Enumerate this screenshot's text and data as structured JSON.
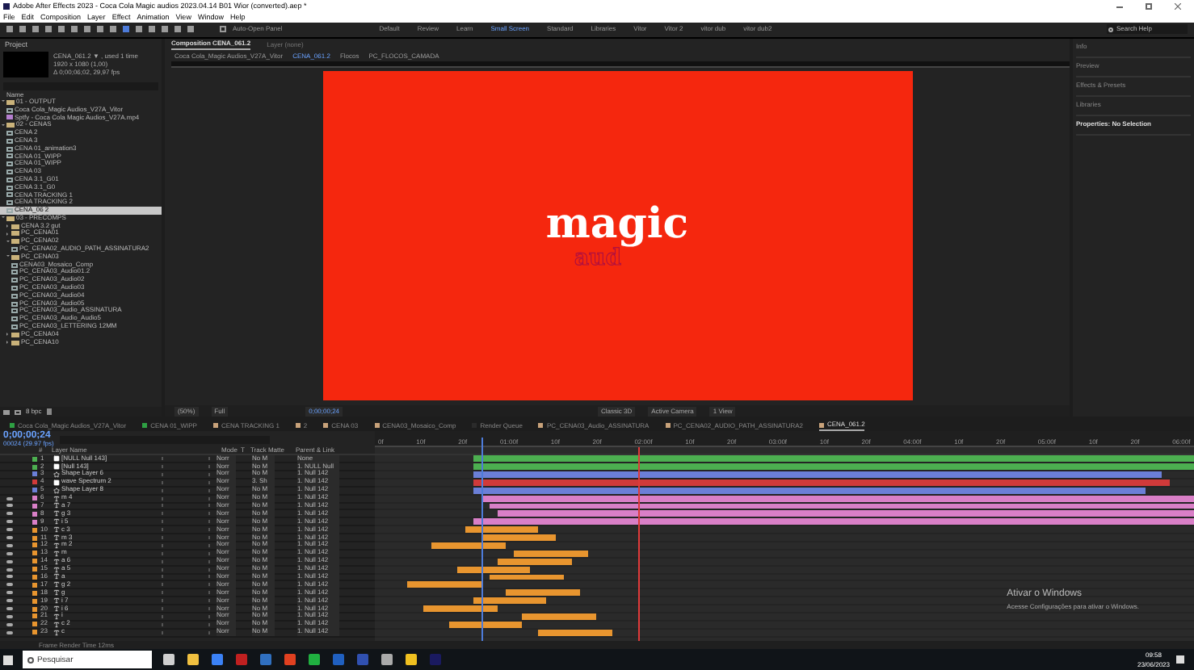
{
  "window": {
    "title": "Adobe After Effects 2023 - Coca Cola Magic audios 2023.04.14 B01 Wior (converted).aep *"
  },
  "menu": [
    "File",
    "Edit",
    "Composition",
    "Layer",
    "Effect",
    "Animation",
    "View",
    "Window",
    "Help"
  ],
  "toolbar": {
    "auto_open": "Auto-Open Panel",
    "workspaces": [
      {
        "label": "Default",
        "selected": false
      },
      {
        "label": "Review",
        "selected": false
      },
      {
        "label": "Learn",
        "selected": false
      },
      {
        "label": "Small Screen",
        "selected": true
      },
      {
        "label": "Standard",
        "selected": false
      },
      {
        "label": "Libraries",
        "selected": false
      },
      {
        "label": "Vitor",
        "selected": false
      },
      {
        "label": "Vitor 2",
        "selected": false
      },
      {
        "label": "vitor dub",
        "selected": false
      },
      {
        "label": "vitor dub2",
        "selected": false
      }
    ],
    "search": {
      "placeholder": "Search Help"
    }
  },
  "project": {
    "title": "Project",
    "info": [
      "CENA_061.2 ▼ , used 1 time",
      "1920 x 1080 (1,00)",
      "Δ 0;00;06;02, 29,97 fps"
    ],
    "column": "Name",
    "tree": [
      {
        "label": "01 - OUTPUT",
        "kind": "folder",
        "expanded": true,
        "selected": false,
        "children": [
          {
            "label": "Coca Cola_Magic Audios_V27A_Vitor",
            "kind": "comp",
            "selected": false
          },
          {
            "label": "Sptfy - Coca Cola Magic Audios_V27A.mp4",
            "kind": "footage",
            "selected": false
          }
        ]
      },
      {
        "label": "02 - CENAS",
        "kind": "folder",
        "expanded": true,
        "selected": false,
        "children": [
          {
            "label": "CENA 2",
            "kind": "comp",
            "selected": false
          },
          {
            "label": "CENA 3",
            "kind": "comp",
            "selected": false
          },
          {
            "label": "CENA 01_animation3",
            "kind": "comp",
            "selected": false
          },
          {
            "label": "CENA 01_WIPP",
            "kind": "comp",
            "selected": false
          },
          {
            "label": "CENA 01_WIPP",
            "kind": "comp",
            "selected": false
          },
          {
            "label": "CENA 03",
            "kind": "comp",
            "selected": false
          },
          {
            "label": "CENA 3.1_G01",
            "kind": "comp",
            "selected": false
          },
          {
            "label": "CENA 3.1_G0",
            "kind": "comp",
            "selected": false
          },
          {
            "label": "CENA TRACKING 1",
            "kind": "comp",
            "selected": false
          },
          {
            "label": "CENA TRACKING 2",
            "kind": "comp",
            "selected": false
          },
          {
            "label": "CENA_06 2",
            "kind": "comp",
            "selected": true
          }
        ]
      },
      {
        "label": "03 - PRECOMPS",
        "kind": "folder",
        "expanded": true,
        "selected": false,
        "children": [
          {
            "label": "CENA 3.2 gut",
            "kind": "folder",
            "expanded": false,
            "selected": false
          },
          {
            "label": "PC_CENA01",
            "kind": "folder",
            "expanded": false,
            "selected": false
          },
          {
            "label": "PC_CENA02",
            "kind": "folder",
            "expanded": true,
            "selected": false,
            "children": [
              {
                "label": "PC_CENA02_AUDIO_PATH_ASSINATURA2",
                "kind": "comp",
                "selected": false
              }
            ]
          },
          {
            "label": "PC_CENA03",
            "kind": "folder",
            "expanded": true,
            "selected": false,
            "children": [
              {
                "label": "CENA03_Mosaico_Comp",
                "kind": "comp",
                "selected": false
              },
              {
                "label": "PC_CENA03_Audio01.2",
                "kind": "comp",
                "selected": false
              },
              {
                "label": "PC_CENA03_Audio02",
                "kind": "comp",
                "selected": false
              },
              {
                "label": "PC_CENA03_Audio03",
                "kind": "comp",
                "selected": false
              },
              {
                "label": "PC_CENA03_Audio04",
                "kind": "comp",
                "selected": false
              },
              {
                "label": "PC_CENA03_Audio05",
                "kind": "comp",
                "selected": false
              },
              {
                "label": "PC_CENA03_Audio_ASSINATURA",
                "kind": "comp",
                "selected": false
              },
              {
                "label": "PC_CENA03_Audio_Audio5",
                "kind": "comp",
                "selected": false
              },
              {
                "label": "PC_CENA03_LETTERING 12MM",
                "kind": "comp",
                "selected": false
              }
            ]
          },
          {
            "label": "PC_CENA04",
            "kind": "folder",
            "expanded": false,
            "selected": false
          },
          {
            "label": "PC_CENA10",
            "kind": "folder",
            "expanded": false,
            "selected": false
          }
        ]
      }
    ],
    "footer": "8 bpc"
  },
  "viewer": {
    "tabs": [
      {
        "label": "Composition CENA_061.2",
        "selected": true
      },
      {
        "label": "Layer (none)",
        "selected": false
      }
    ],
    "breadcrumbs": [
      "Coca Cola_Magic Audios_V27A_Vitor",
      "CENA_061.2",
      "Flocos",
      "PC_FLOCOS_CAMADA"
    ],
    "canvas": {
      "title": "magic",
      "subtitle": "aud"
    },
    "bottom": [
      "(50%)",
      "Full",
      "0;00;00;24",
      "Classic 3D",
      "Active Camera",
      "1 View"
    ]
  },
  "side_panels": [
    {
      "label": "Info",
      "expanded": false
    },
    {
      "label": "Preview",
      "expanded": false
    },
    {
      "label": "Effects & Presets",
      "expanded": false
    },
    {
      "label": "Libraries",
      "expanded": false
    },
    {
      "label": "Properties: No Selection",
      "expanded": true
    }
  ],
  "timeline": {
    "tabs": [
      {
        "label": "Coca Cola_Magic Audios_V27A_Vitor",
        "selected": false,
        "color": "#2ea043"
      },
      {
        "label": "CENA 01_WIPP",
        "selected": false,
        "color": "#2ea043"
      },
      {
        "label": "CENA TRACKING 1",
        "selected": false,
        "color": "#c8a27a"
      },
      {
        "label": "2",
        "selected": false,
        "color": "#c8a27a"
      },
      {
        "label": "CENA 03",
        "selected": false,
        "color": "#c8a27a"
      },
      {
        "label": "CENA03_Mosaico_Comp",
        "selected": false,
        "color": "#c8a27a"
      },
      {
        "label": "Render Queue",
        "selected": false,
        "color": "#2b2b2b"
      },
      {
        "label": "PC_CENA03_Audio_ASSINATURA",
        "selected": false,
        "color": "#c8a27a"
      },
      {
        "label": "PC_CENA02_AUDIO_PATH_ASSINATURA2",
        "selected": false,
        "color": "#c8a27a"
      },
      {
        "label": "CENA_061.2",
        "selected": true,
        "color": "#c8a27a"
      }
    ],
    "time": "0;00;00;24",
    "fps": "00024 (29.97 fps)",
    "columns": [
      "#",
      "Layer Name",
      "Mode",
      "T",
      "Track Matte",
      "Parent & Link"
    ],
    "ruler": [
      "0f",
      "10f",
      "20f",
      "01:00f",
      "10f",
      "20f",
      "02:00f",
      "10f",
      "20f",
      "03:00f",
      "10f",
      "20f",
      "04:00f",
      "10f",
      "20f",
      "05:00f",
      "10f",
      "20f",
      "06:00f"
    ],
    "layers": [
      {
        "num": "1",
        "name": "[NULL Null 143]",
        "kind": "solid",
        "color": "#4caf50",
        "visible": false,
        "mode": "Norr",
        "matte": "No M",
        "parent": "None"
      },
      {
        "num": "2",
        "name": "[Null 143]",
        "kind": "solid",
        "color": "#4caf50",
        "visible": false,
        "mode": "Norr",
        "matte": "No M",
        "parent": "1. NULL Null"
      },
      {
        "num": "3",
        "name": "Shape Layer 6",
        "kind": "shape",
        "color": "#6b7fd7",
        "visible": false,
        "mode": "Norr",
        "matte": "No M",
        "parent": "1. Null 142"
      },
      {
        "num": "4",
        "name": "wave Spectrum 2",
        "kind": "solid",
        "color": "#d03a3a",
        "visible": false,
        "mode": "Norr",
        "matte": "3. Sh",
        "parent": "1. Null 142"
      },
      {
        "num": "5",
        "name": "Shape Layer 8",
        "kind": "shape",
        "color": "#6b7fd7",
        "visible": false,
        "mode": "Norr",
        "matte": "No M",
        "parent": "1. Null 142"
      },
      {
        "num": "6",
        "name": "m 4",
        "kind": "text",
        "color": "#d97fc7",
        "visible": true,
        "mode": "Norr",
        "matte": "No M",
        "parent": "1. Null 142"
      },
      {
        "num": "7",
        "name": "a 7",
        "kind": "text",
        "color": "#d97fc7",
        "visible": true,
        "mode": "Norr",
        "matte": "No M",
        "parent": "1. Null 142"
      },
      {
        "num": "8",
        "name": "g 3",
        "kind": "text",
        "color": "#d97fc7",
        "visible": true,
        "mode": "Norr",
        "matte": "No M",
        "parent": "1. Null 142"
      },
      {
        "num": "9",
        "name": "i 5",
        "kind": "text",
        "color": "#d97fc7",
        "visible": true,
        "mode": "Norr",
        "matte": "No M",
        "parent": "1. Null 142"
      },
      {
        "num": "10",
        "name": "c 3",
        "color": "#e8952f",
        "visible": true,
        "kind": "clip",
        "mode": "Norr",
        "matte": "No M",
        "parent": "1. Null 142"
      },
      {
        "num": "11",
        "name": "m 3",
        "color": "#e8952f",
        "visible": true,
        "kind": "clip",
        "mode": "Norr",
        "matte": "No M",
        "parent": "1. Null 142"
      },
      {
        "num": "12",
        "name": "m 2",
        "color": "#e8952f",
        "visible": true,
        "kind": "clip",
        "mode": "Norr",
        "matte": "No M",
        "parent": "1. Null 142"
      },
      {
        "num": "13",
        "name": "m",
        "color": "#e8952f",
        "visible": true,
        "kind": "clip",
        "mode": "Norr",
        "matte": "No M",
        "parent": "1. Null 142"
      },
      {
        "num": "14",
        "name": "a 6",
        "color": "#e8952f",
        "visible": true,
        "kind": "clip",
        "mode": "Norr",
        "matte": "No M",
        "parent": "1. Null 142"
      },
      {
        "num": "15",
        "name": "a 5",
        "color": "#e8952f",
        "visible": true,
        "kind": "clip",
        "mode": "Norr",
        "matte": "No M",
        "parent": "1. Null 142"
      },
      {
        "num": "16",
        "name": "a",
        "color": "#e8952f",
        "visible": true,
        "kind": "clip",
        "mode": "Norr",
        "matte": "No M",
        "parent": "1. Null 142"
      },
      {
        "num": "17",
        "name": "g 2",
        "color": "#e8952f",
        "visible": true,
        "kind": "clip",
        "mode": "Norr",
        "matte": "No M",
        "parent": "1. Null 142"
      },
      {
        "num": "18",
        "name": "g",
        "color": "#e8952f",
        "visible": true,
        "kind": "clip",
        "mode": "Norr",
        "matte": "No M",
        "parent": "1. Null 142"
      },
      {
        "num": "19",
        "name": "i 7",
        "color": "#e8952f",
        "visible": true,
        "kind": "clip",
        "mode": "Norr",
        "matte": "No M",
        "parent": "1. Null 142"
      },
      {
        "num": "20",
        "name": "i 6",
        "color": "#e8952f",
        "visible": true,
        "kind": "clip",
        "mode": "Norr",
        "matte": "No M",
        "parent": "1. Null 142"
      },
      {
        "num": "21",
        "name": "i",
        "color": "#e8952f",
        "visible": true,
        "kind": "clip",
        "mode": "Norr",
        "matte": "No M",
        "parent": "1. Null 142"
      },
      {
        "num": "22",
        "name": "c 2",
        "color": "#e8952f",
        "visible": true,
        "kind": "clip",
        "mode": "Norr",
        "matte": "No M",
        "parent": "1. Null 142"
      },
      {
        "num": "23",
        "name": "c",
        "color": "#e8952f",
        "visible": true,
        "kind": "clip",
        "mode": "Norr",
        "matte": "No M",
        "parent": "1. Null 142"
      }
    ],
    "footer": "Frame Render Time  12ms"
  },
  "activation": {
    "title": "Ativar o Windows",
    "text": "Acesse Configurações para ativar o Windows."
  },
  "taskbar": {
    "search": {
      "placeholder": "Pesquisar"
    },
    "time": "09:58",
    "date": "23/06/2023"
  }
}
